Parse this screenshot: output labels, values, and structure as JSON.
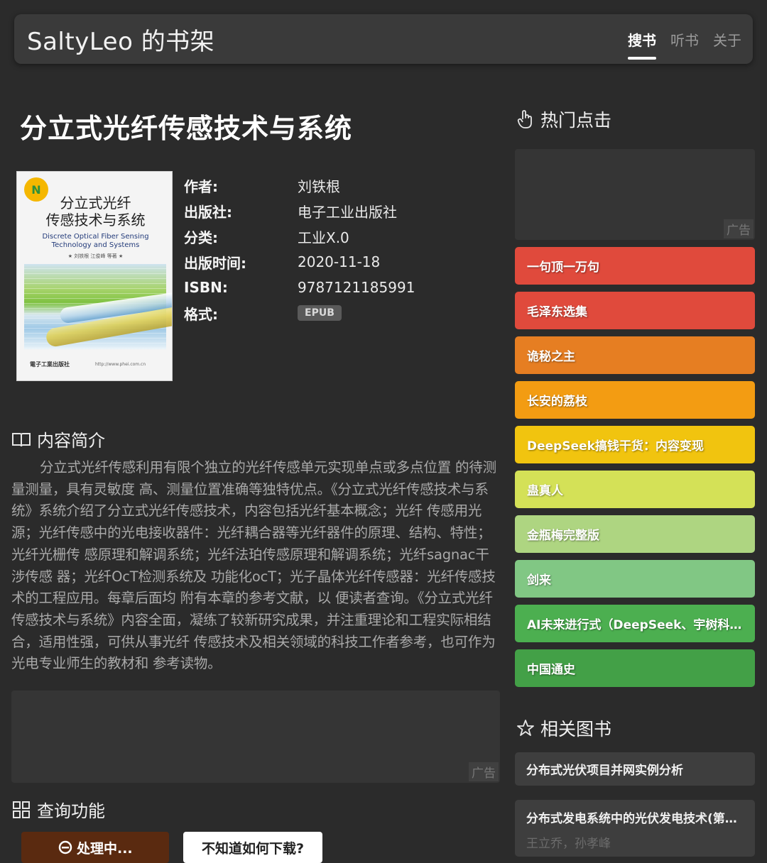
{
  "navbar": {
    "brand": "SaltyLeo 的书架",
    "links": [
      "搜书",
      "听书",
      "关于"
    ]
  },
  "book": {
    "title": "分立式光纤传感技术与系统",
    "cover": {
      "title_cn_line1": "分立式光纤",
      "title_cn_line2": "传感技术与系统",
      "title_en_line1": "Discrete Optical Fiber Sensing",
      "title_en_line2": "Technology and Systems",
      "authors": "★ 刘铁根  江俊峰  等著 ★",
      "logo_text": "N",
      "publisher": "電子工業出版社",
      "url": "http://www.phei.com.cn"
    },
    "meta": [
      {
        "label": "作者:",
        "value": "刘铁根"
      },
      {
        "label": "出版社:",
        "value": "电子工业出版社"
      },
      {
        "label": "分类:",
        "value": "工业X.0"
      },
      {
        "label": "出版时间:",
        "value": "2020-11-18"
      },
      {
        "label": "ISBN:",
        "value": "9787121185991"
      },
      {
        "label": "格式:",
        "value": "EPUB"
      }
    ]
  },
  "intro": {
    "heading": "内容简介",
    "text": "分立式光纤传感利用有限个独立的光纤传感单元实现单点或多点位置 的待测量测量，具有灵敏度 高、测量位置准确等独特优点。《分立式光纤传感技术与系统》系统介绍了分立式光纤传感技术，内容包括光纤基本概念；光纤 传感用光源；光纤传感中的光电接收器件：光纤耦合器等光纤器件的原理、结构、特性；光纤光栅传 感原理和解调系统；光纤法珀传感原理和解调系统；光纤sagnac干涉传感 器；光纤OcT检测系统及 功能化ocT；光子晶体光纤传感器：光纤传感技术的工程应用。每章后面均 附有本章的参考文献，以 便读者查询。《分立式光纤传感技术与系统》内容全面，凝练了较新研究成果，并注重理论和工程实际相结合，适用性强，可供从事光纤 传感技术及相关领域的科技工作者参考，也可作为光电专业师生的教材和 参考读物。"
  },
  "ad_label": "广告",
  "query": {
    "heading": "查询功能",
    "processing_label": "处理中...",
    "help_label": "不知道如何下载?"
  },
  "sidebar": {
    "hot_heading": "热门点击",
    "hot_items": [
      {
        "label": "一句顶一万句",
        "color": "#e04a3c"
      },
      {
        "label": "毛泽东选集",
        "color": "#e04a3c"
      },
      {
        "label": "诡秘之主",
        "color": "#e67e22"
      },
      {
        "label": "长安的荔枝",
        "color": "#f39c12"
      },
      {
        "label": "DeepSeek搞钱干货：内容变现",
        "color": "#f1c40f"
      },
      {
        "label": "蛊真人",
        "color": "#d4e157"
      },
      {
        "label": "金瓶梅完整版",
        "color": "#aed581"
      },
      {
        "label": "剑来",
        "color": "#81c784"
      },
      {
        "label": "AI未来进行式（DeepSeek、宇树科…",
        "color": "#4caf50"
      },
      {
        "label": "中国通史",
        "color": "#43a047"
      }
    ],
    "related_heading": "相关图书",
    "related_items": [
      {
        "title": "分布式光伏项目并网实例分析"
      },
      {
        "title": "分布式发电系统中的光伏发电技术(第…",
        "author": "王立乔，孙孝峰"
      }
    ]
  }
}
